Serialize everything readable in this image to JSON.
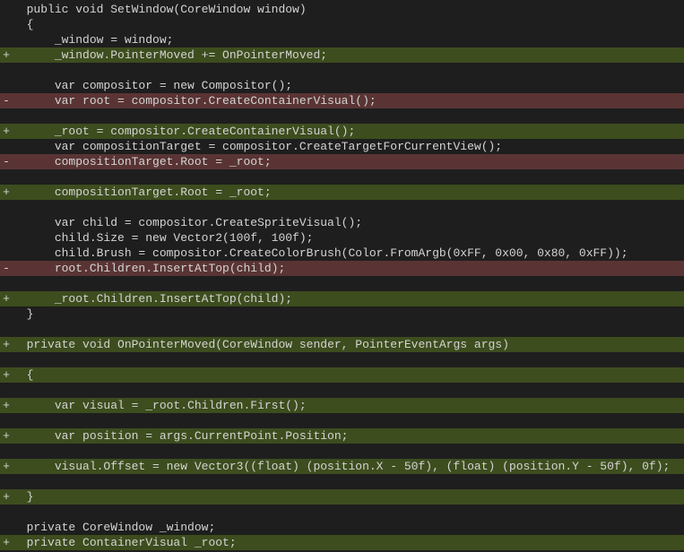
{
  "lines": [
    {
      "gutter": " ",
      "cls": "",
      "indent": "  ",
      "text": "public void SetWindow(CoreWindow window)"
    },
    {
      "gutter": " ",
      "cls": "",
      "indent": "  ",
      "text": "{"
    },
    {
      "gutter": " ",
      "cls": "",
      "indent": "      ",
      "text": "_window = window;"
    },
    {
      "gutter": "+",
      "cls": "line-added",
      "indent": "      ",
      "text": "_window.PointerMoved += OnPointerMoved;"
    },
    {
      "gutter": " ",
      "cls": "",
      "indent": "",
      "text": ""
    },
    {
      "gutter": " ",
      "cls": "",
      "indent": "      ",
      "text": "var compositor = new Compositor();"
    },
    {
      "gutter": "-",
      "cls": "line-removed",
      "indent": "      ",
      "text": "var root = compositor.CreateContainerVisual();"
    },
    {
      "gutter": " ",
      "cls": "",
      "indent": "",
      "text": ""
    },
    {
      "gutter": "+",
      "cls": "line-added",
      "indent": "      ",
      "text": "_root = compositor.CreateContainerVisual();"
    },
    {
      "gutter": " ",
      "cls": "",
      "indent": "      ",
      "text": "var compositionTarget = compositor.CreateTargetForCurrentView();"
    },
    {
      "gutter": "-",
      "cls": "line-removed",
      "indent": "      ",
      "text": "compositionTarget.Root = _root;"
    },
    {
      "gutter": " ",
      "cls": "",
      "indent": "",
      "text": ""
    },
    {
      "gutter": "+",
      "cls": "line-added",
      "indent": "      ",
      "text": "compositionTarget.Root = _root;"
    },
    {
      "gutter": " ",
      "cls": "",
      "indent": "",
      "text": ""
    },
    {
      "gutter": " ",
      "cls": "",
      "indent": "      ",
      "text": "var child = compositor.CreateSpriteVisual();"
    },
    {
      "gutter": " ",
      "cls": "",
      "indent": "      ",
      "text": "child.Size = new Vector2(100f, 100f);"
    },
    {
      "gutter": " ",
      "cls": "",
      "indent": "      ",
      "text": "child.Brush = compositor.CreateColorBrush(Color.FromArgb(0xFF, 0x00, 0x80, 0xFF));"
    },
    {
      "gutter": "-",
      "cls": "line-removed",
      "indent": "      ",
      "text": "root.Children.InsertAtTop(child);"
    },
    {
      "gutter": " ",
      "cls": "",
      "indent": "",
      "text": ""
    },
    {
      "gutter": "+",
      "cls": "line-added",
      "indent": "      ",
      "text": "_root.Children.InsertAtTop(child);"
    },
    {
      "gutter": " ",
      "cls": "",
      "indent": "  ",
      "text": "}"
    },
    {
      "gutter": " ",
      "cls": "",
      "indent": "",
      "text": ""
    },
    {
      "gutter": "+",
      "cls": "line-added",
      "indent": "  ",
      "text": "private void OnPointerMoved(CoreWindow sender, PointerEventArgs args)"
    },
    {
      "gutter": " ",
      "cls": "",
      "indent": "",
      "text": ""
    },
    {
      "gutter": "+",
      "cls": "line-added",
      "indent": "  ",
      "text": "{"
    },
    {
      "gutter": " ",
      "cls": "",
      "indent": "",
      "text": ""
    },
    {
      "gutter": "+",
      "cls": "line-added",
      "indent": "      ",
      "text": "var visual = _root.Children.First();"
    },
    {
      "gutter": " ",
      "cls": "",
      "indent": "",
      "text": ""
    },
    {
      "gutter": "+",
      "cls": "line-added",
      "indent": "      ",
      "text": "var position = args.CurrentPoint.Position;"
    },
    {
      "gutter": " ",
      "cls": "",
      "indent": "",
      "text": ""
    },
    {
      "gutter": "+",
      "cls": "line-added",
      "indent": "      ",
      "text": "visual.Offset = new Vector3((float) (position.X - 50f), (float) (position.Y - 50f), 0f);"
    },
    {
      "gutter": " ",
      "cls": "",
      "indent": "",
      "text": ""
    },
    {
      "gutter": "+",
      "cls": "line-added",
      "indent": "  ",
      "text": "}"
    },
    {
      "gutter": " ",
      "cls": "",
      "indent": "",
      "text": ""
    },
    {
      "gutter": " ",
      "cls": "",
      "indent": "  ",
      "text": "private CoreWindow _window;"
    },
    {
      "gutter": "+",
      "cls": "line-added",
      "indent": "  ",
      "text": "private ContainerVisual _root;"
    }
  ]
}
